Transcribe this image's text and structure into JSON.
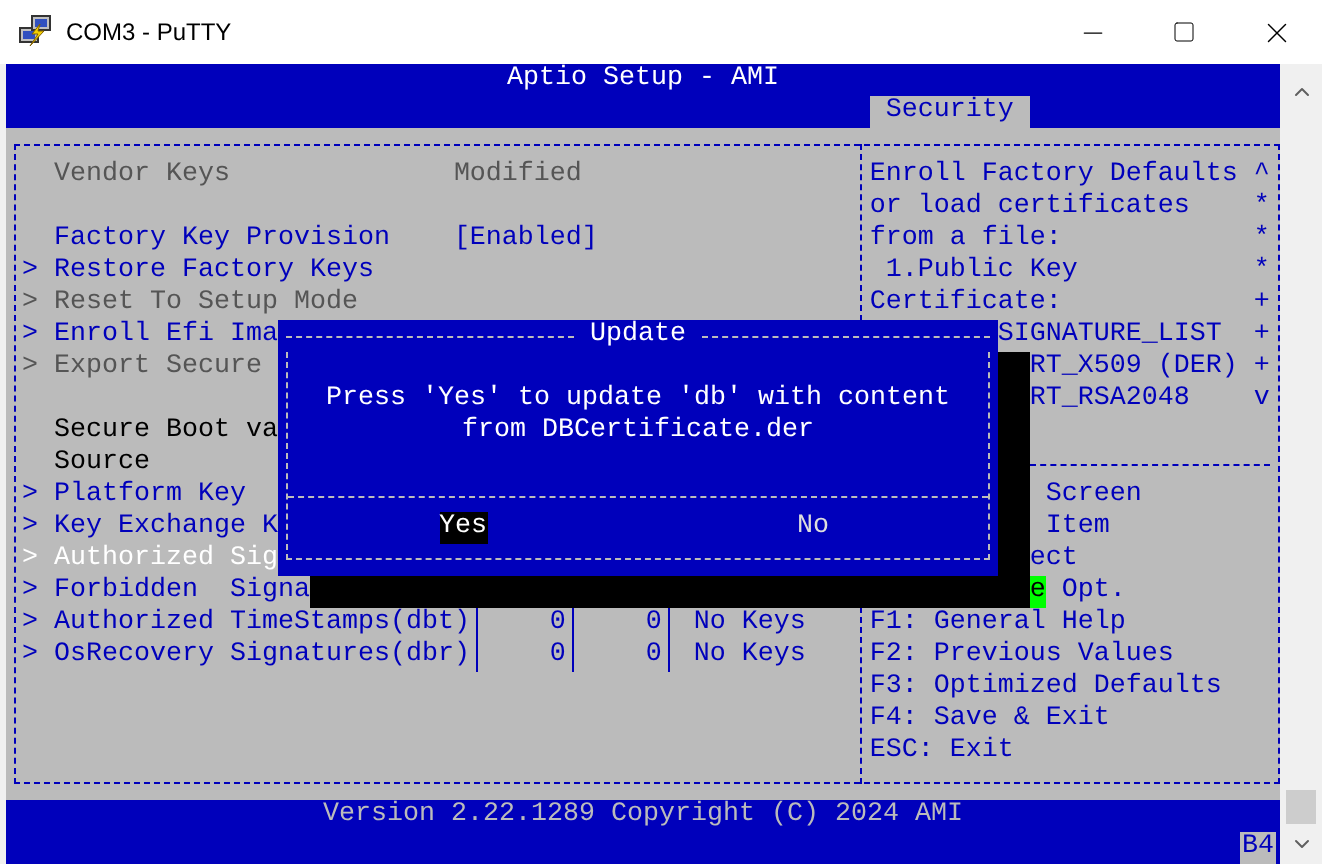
{
  "window": {
    "title": "COM3 - PuTTY"
  },
  "header": {
    "title": "Aptio Setup - AMI",
    "tabs": [
      {
        "label": "Security",
        "selected": true
      }
    ]
  },
  "settings": {
    "sections": [
      [
        {
          "kind": "info",
          "label": "Vendor Keys",
          "value": "Modified",
          "disabled": true,
          "selected": false
        }
      ],
      [
        {
          "kind": "setting",
          "label": "Factory Key Provision",
          "value": "[Enabled]",
          "disabled": false,
          "selected": false
        },
        {
          "kind": "link",
          "marker": ">",
          "label": "Restore Factory Keys",
          "disabled": false,
          "selected": false
        },
        {
          "kind": "link",
          "marker": ">",
          "label": "Reset To Setup Mode",
          "disabled": true,
          "selected": false
        },
        {
          "kind": "link",
          "marker": ">",
          "label": "Enroll Efi Ima",
          "disabled": false,
          "selected": false
        },
        {
          "kind": "link",
          "marker": ">",
          "label": "Export Secure",
          "disabled": true,
          "selected": false
        }
      ],
      [
        {
          "kind": "info",
          "label": "Secure Boot va",
          "disabled": false,
          "selected": false
        },
        {
          "kind": "info",
          "label": "Source",
          "disabled": false,
          "selected": false
        },
        {
          "kind": "link",
          "marker": ">",
          "label": "Platform Key",
          "disabled": false,
          "selected": false
        },
        {
          "kind": "link",
          "marker": ">",
          "label": "Key Exchange K",
          "disabled": false,
          "selected": false
        },
        {
          "kind": "link",
          "marker": ">",
          "label": "Authorized Sig",
          "disabled": false,
          "selected": true
        },
        {
          "kind": "link",
          "marker": ">",
          "label": "Forbidden  Signa",
          "disabled": false,
          "selected": false
        },
        {
          "kind": "table_row",
          "marker": ">",
          "label": "Authorized TimeStamps(dbt)",
          "cells": [
            "0",
            "0",
            "No Keys"
          ],
          "disabled": false,
          "selected": false
        },
        {
          "kind": "table_row",
          "marker": ">",
          "label": "OsRecovery Signatures(dbr)",
          "cells": [
            "0",
            "0",
            "No Keys"
          ],
          "disabled": false,
          "selected": false
        }
      ]
    ]
  },
  "help": {
    "lines": [
      {
        "text": "Enroll Factory Defaults",
        "mark": "^"
      },
      {
        "text": "or load certificates",
        "mark": "*"
      },
      {
        "text": "from a file:",
        "mark": "*"
      },
      {
        "text": "1.Public Key",
        "mark": "*"
      },
      {
        "text": "Certificate:",
        "mark": "+"
      },
      {
        "text": "SIGNATURE_LIST",
        "mark": "+"
      },
      {
        "text": "RT_X509 (DER)",
        "mark": "+"
      },
      {
        "text": "RT_RSA2048",
        "mark": "v"
      }
    ]
  },
  "key_help": {
    "lines": [
      {
        "parts": [
          {
            "text": "Screen",
            "highlighted": false
          }
        ]
      },
      {
        "parts": [
          {
            "text": "Item",
            "highlighted": false
          }
        ]
      },
      {
        "parts": [
          {
            "text": "ect",
            "highlighted": false
          }
        ]
      },
      {
        "parts": [
          {
            "text": "e",
            "highlighted": true
          },
          {
            "text": "Opt.",
            "highlighted": false
          }
        ]
      },
      {
        "parts": [
          {
            "text": "F1: General Help",
            "highlighted": false
          }
        ]
      },
      {
        "parts": [
          {
            "text": "F2: Previous Values",
            "highlighted": false
          }
        ]
      },
      {
        "parts": [
          {
            "text": "F3: Optimized Defaults",
            "highlighted": false
          }
        ]
      },
      {
        "parts": [
          {
            "text": "F4: Save & Exit",
            "highlighted": false
          }
        ]
      },
      {
        "parts": [
          {
            "text": "ESC: Exit",
            "highlighted": false
          }
        ]
      }
    ]
  },
  "dialog": {
    "title": "Update",
    "message": "Press 'Yes' to update 'db' with content from DBCertificate.der",
    "buttons": [
      {
        "label": "Yes",
        "selected": true
      },
      {
        "label": "No",
        "selected": false
      }
    ]
  },
  "footer": {
    "text": "Version 2.22.1289 Copyright (C) 2024 AMI",
    "badge": "B4"
  }
}
